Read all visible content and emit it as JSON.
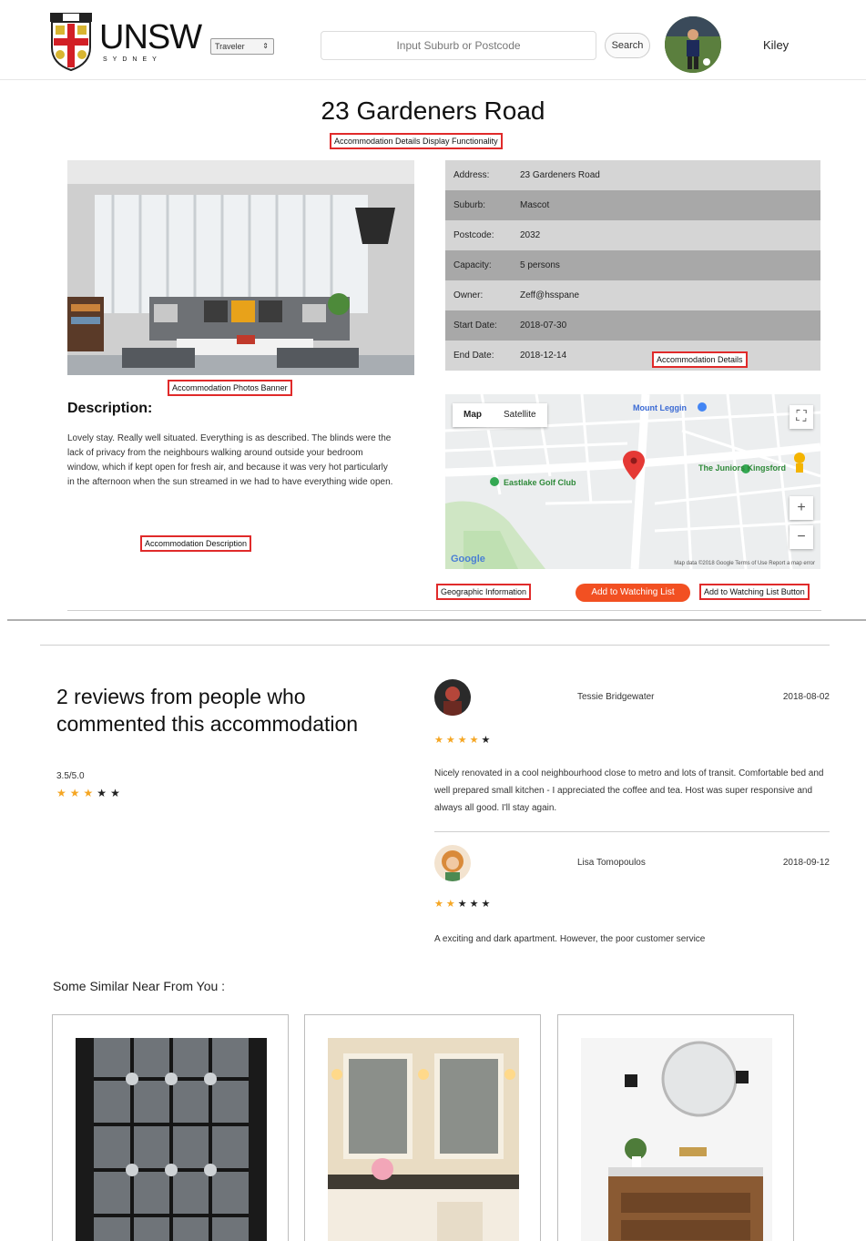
{
  "header": {
    "logo_text": "UNSW",
    "logo_subtext": "SYDNEY",
    "type_select_value": "Traveler",
    "search_placeholder": "Input Suburb or Postcode",
    "search_button": "Search",
    "user_name": "Kiley"
  },
  "listing": {
    "title": "23 Gardeners Road",
    "details": [
      {
        "label": "Address:",
        "value": "23 Gardeners Road"
      },
      {
        "label": "Suburb:",
        "value": "Mascot"
      },
      {
        "label": "Postcode:",
        "value": "2032"
      },
      {
        "label": "Capacity:",
        "value": "5 persons"
      },
      {
        "label": "Owner:",
        "value": "Zeff@hsspane"
      },
      {
        "label": "Start Date:",
        "value": "2018-07-30"
      },
      {
        "label": "End Date:",
        "value": "2018-12-14"
      }
    ],
    "description_heading": "Description:",
    "description_text": "Lovely stay. Really well situated. Everything is as described. The blinds were the lack of privacy from the neighbours walking around outside your bedroom window, which if kept open for fresh air, and because it was very hot particularly in the afternoon when the sun streamed in we had to have everything wide open.",
    "watch_button": "Add to Watching List"
  },
  "annotations": {
    "page": "Accommodation Details Display Functionality",
    "photos": "Accommodation Photos Banner",
    "description": "Accommodation Description",
    "details": "Accommodation Details",
    "geo": "Geographic Information",
    "watch": "Add to Watching List Button"
  },
  "map": {
    "tab_map": "Map",
    "tab_satellite": "Satellite",
    "label_golf": "Eastlake Golf Club",
    "label_park": "The Juniors Kingsford",
    "label_top": "Mount Leggin",
    "google": "Google",
    "footer": "Map data ©2018 Google  Terms of Use  Report a map error",
    "btn_fullscreen": "⛶",
    "btn_zoom_in": "+",
    "btn_zoom_out": "−"
  },
  "reviews": {
    "heading": "2 reviews from people who commented this accommodation",
    "score": "3.5/5.0",
    "average_stars": 3,
    "max_stars": 5,
    "items": [
      {
        "name": "Tessie Bridgewater",
        "date": "2018-08-02",
        "stars": 4,
        "text": "Nicely renovated in a cool neighbourhood close to metro and lots of transit. Comfortable bed and well prepared small kitchen - I appreciated the coffee and tea. Host was super responsive and always all good. I'll stay again."
      },
      {
        "name": "Lisa Tomopoulos",
        "date": "2018-09-12",
        "stars": 2,
        "text": "A exciting and dark apartment. However, the poor customer service"
      }
    ]
  },
  "similar": {
    "title": "Some Similar Near From You :"
  },
  "colors": {
    "accent": "#f25022",
    "annotation_border": "#e02a2a",
    "star_filled": "#f5a623",
    "row_light": "#d5d5d5",
    "row_dark": "#a8a8a8"
  }
}
